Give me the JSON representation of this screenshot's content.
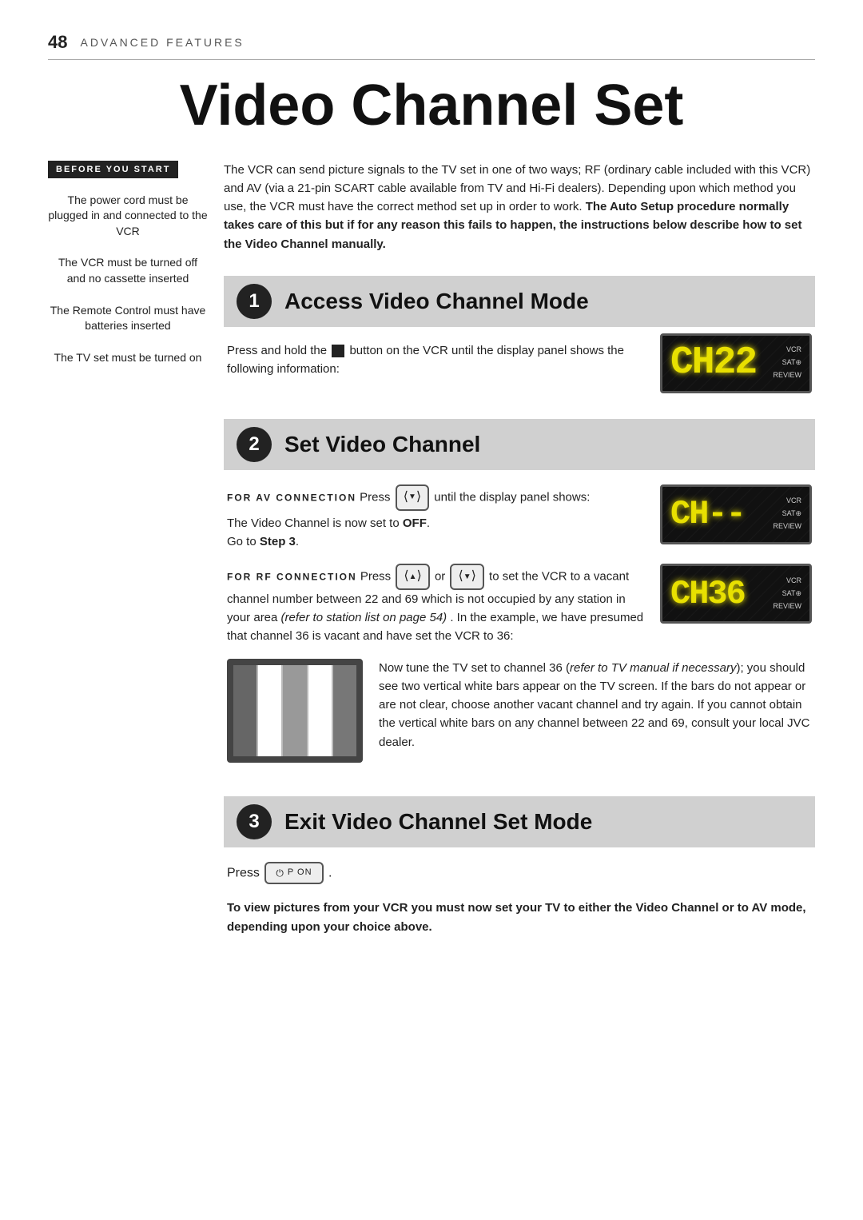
{
  "header": {
    "page_number": "48",
    "section": "ADVANCED FEATURES"
  },
  "title": "Video Channel Set",
  "sidebar": {
    "badge": "BEFORE YOU START",
    "items": [
      "The power cord must be plugged in and connected to the VCR",
      "The VCR must be turned off and no cassette inserted",
      "The Remote Control must have batteries inserted",
      "The TV set must be turned on"
    ]
  },
  "intro": {
    "text": "The VCR can send picture signals to the TV set in one of two ways; RF (ordinary cable included with this VCR) and AV (via a 21-pin SCART cable available from TV and Hi-Fi dealers). Depending upon which method you use, the VCR must have the correct method set up in order to work. The Auto Setup procedure normally takes care of this but if for any reason this fails to happen, the instructions below describe how to set the Video Channel manually."
  },
  "steps": [
    {
      "number": "1",
      "title": "Access Video Channel Mode",
      "body_parts": [
        "Press and hold the",
        "button on the VCR until the display panel shows the following information:"
      ],
      "display": {
        "digits": "CH22",
        "label1": "VCR",
        "label2": "SAT⊕",
        "label3": "REVIEW"
      }
    },
    {
      "number": "2",
      "title": "Set Video Channel",
      "av_label": "FOR AV CONNECTION",
      "av_text_parts": [
        "Press",
        "until the display panel shows:",
        "The Video Channel is now set to OFF.",
        "Go to Step 3."
      ],
      "av_display": {
        "digits": "CH--",
        "label1": "VCR",
        "label2": "SAT⊕",
        "label3": "REVIEW"
      },
      "rf_label": "FOR RF CONNECTION",
      "rf_text_parts": [
        "Press",
        "or",
        "to set the VCR to a vacant channel number between 22 and 69 which is not occupied by any station in your area"
      ],
      "rf_text_italic": "(refer to station list on page 54)",
      "rf_text_end": ". In the example, we have presumed that channel 36 is vacant and have set the VCR to 36:",
      "rf_display": {
        "digits": "CH36",
        "label1": "VCR",
        "label2": "SAT⊕",
        "label3": "REVIEW"
      },
      "tv_note": "Now tune the TV set to channel 36 (refer to TV manual if necessary); you should see two vertical white bars appear on the TV screen. If the bars do not appear or are not clear, choose another vacant channel and try again. If you cannot obtain the vertical white bars on any channel between 22 and 69, consult your local JVC dealer."
    },
    {
      "number": "3",
      "title": "Exit Video Channel Set Mode",
      "press_label": "Press",
      "button_label": "P ON",
      "note": "To view pictures from your VCR you must now set your TV to either the Video Channel or to AV mode, depending upon your choice above."
    }
  ]
}
